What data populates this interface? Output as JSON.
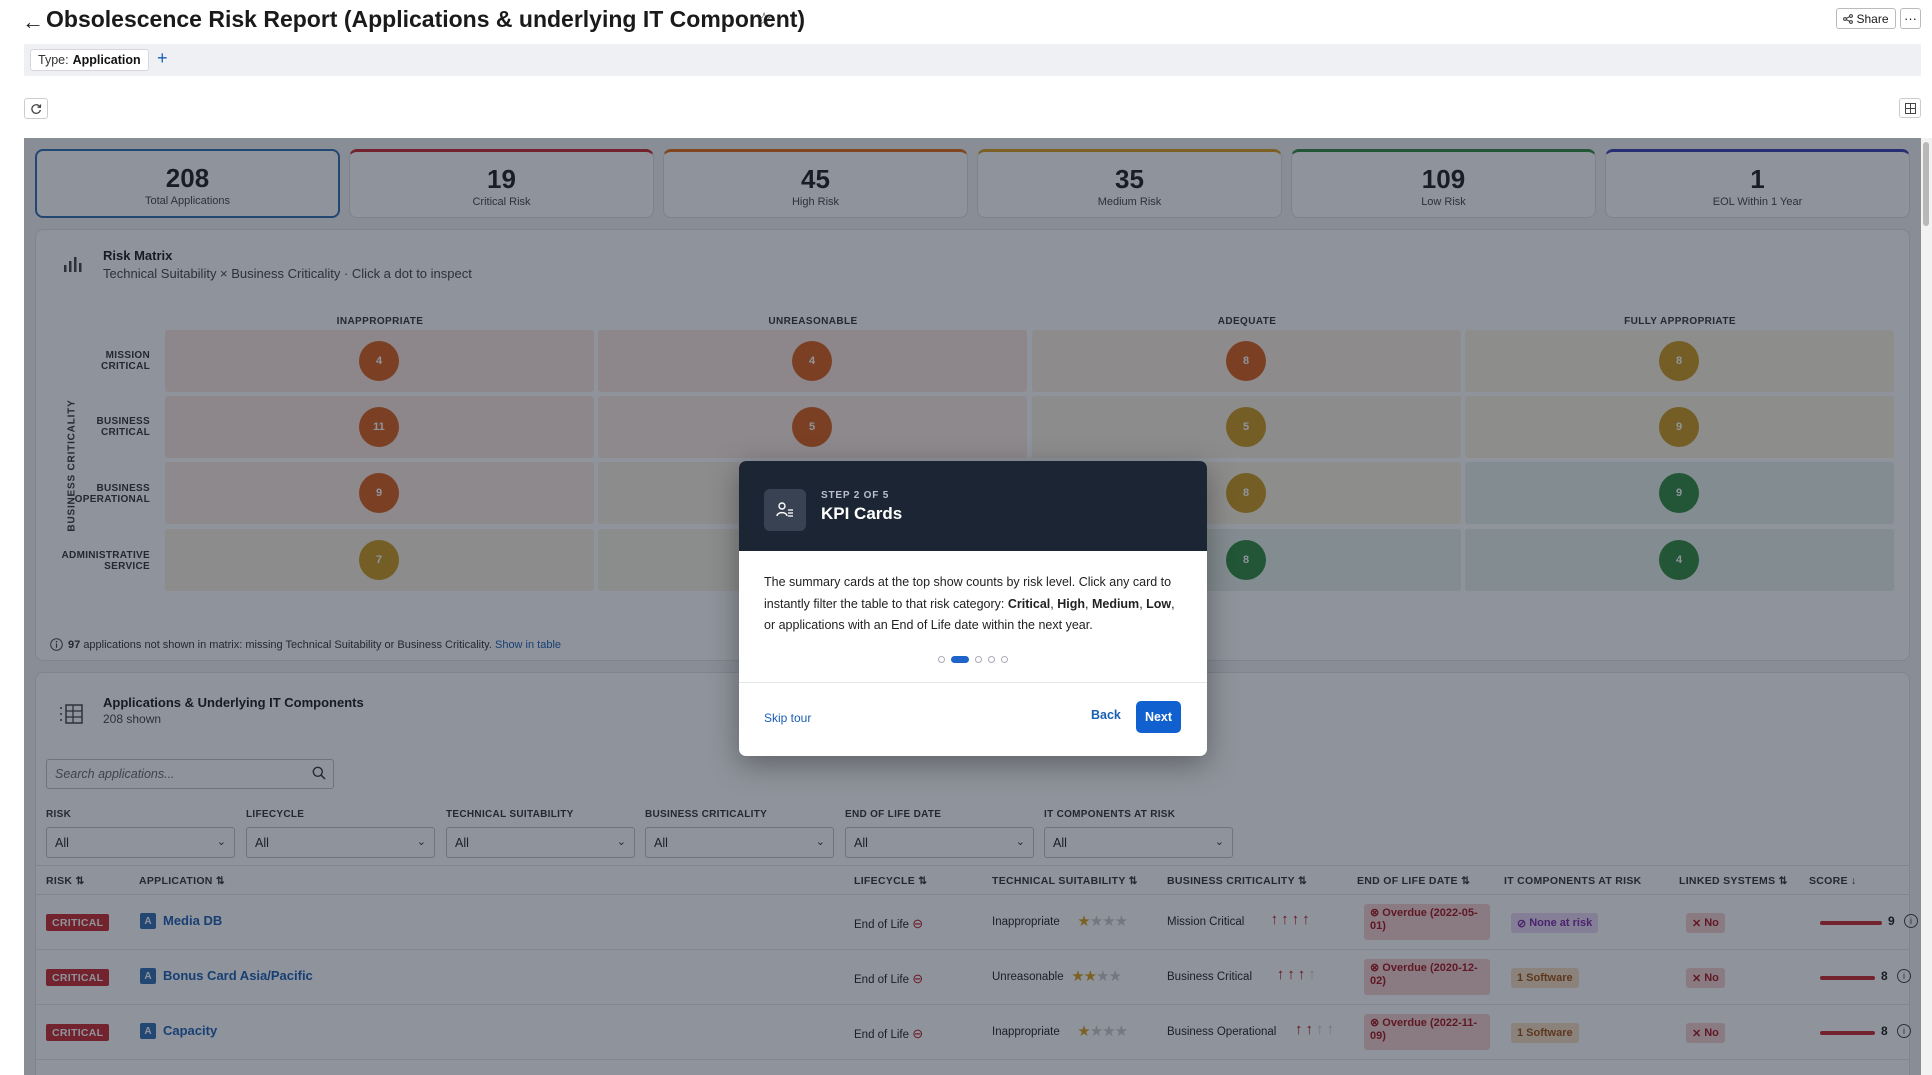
{
  "header": {
    "title": "Obsolescence Risk Report (Applications & underlying IT Component)",
    "share_label": "Share",
    "more_label": "···"
  },
  "filter": {
    "type_prefix": "Type:",
    "type_value": "Application",
    "add_label": "+"
  },
  "kpis": [
    {
      "value": "208",
      "label": "Total Applications",
      "color": "#2f6db3"
    },
    {
      "value": "19",
      "label": "Critical Risk",
      "color": "#c8292f"
    },
    {
      "value": "45",
      "label": "High Risk",
      "color": "#e06b14"
    },
    {
      "value": "35",
      "label": "Medium Risk",
      "color": "#d8a21b"
    },
    {
      "value": "109",
      "label": "Low Risk",
      "color": "#2e8b3e"
    },
    {
      "value": "1",
      "label": "EOL Within 1 Year",
      "color": "#3a3fb0"
    }
  ],
  "matrix": {
    "title": "Risk Matrix",
    "subtitle": "Technical Suitability × Business Criticality · Click a dot to inspect",
    "y_axis_label": "BUSINESS CRITICALITY",
    "columns": [
      "INAPPROPRIATE",
      "UNREASONABLE",
      "ADEQUATE",
      "FULLY APPROPRIATE"
    ],
    "rows": [
      {
        "label_1": "MISSION",
        "label_2": "CRITICAL",
        "values": [
          "4",
          "4",
          "8",
          "8"
        ]
      },
      {
        "label_1": "BUSINESS",
        "label_2": "CRITICAL",
        "values": [
          "11",
          "5",
          "5",
          "9"
        ]
      },
      {
        "label_1": "BUSINESS",
        "label_2": "OPERATIONAL",
        "values": [
          "9",
          "",
          "8",
          "9"
        ]
      },
      {
        "label_1": "ADMINISTRATIVE",
        "label_2": "SERVICE",
        "values": [
          "7",
          "",
          "8",
          "4"
        ]
      }
    ],
    "note_count": "97",
    "note_text": "applications not shown in matrix: missing Technical Suitability or Business Criticality.",
    "note_link": "Show in table"
  },
  "apps": {
    "title": "Applications & Underlying IT Components",
    "subtitle": "208 shown",
    "search_placeholder": "Search applications...",
    "filters": [
      {
        "label": "RISK",
        "value": "All"
      },
      {
        "label": "LIFECYCLE",
        "value": "All"
      },
      {
        "label": "TECHNICAL SUITABILITY",
        "value": "All"
      },
      {
        "label": "BUSINESS CRITICALITY",
        "value": "All"
      },
      {
        "label": "END OF LIFE DATE",
        "value": "All"
      },
      {
        "label": "IT COMPONENTS AT RISK",
        "value": "All"
      }
    ],
    "columns": [
      "RISK ⇅",
      "APPLICATION ⇅",
      "LIFECYCLE ⇅",
      "TECHNICAL SUITABILITY ⇅",
      "BUSINESS CRITICALITY ⇅",
      "END OF LIFE DATE ⇅",
      "IT COMPONENTS AT RISK",
      "LINKED SYSTEMS ⇅",
      "SCORE ↓"
    ],
    "rows": [
      {
        "risk": "CRITICAL",
        "icon": "A",
        "name": "Media DB",
        "lifecycle": "End of Life",
        "tech": "Inappropriate",
        "tech_stars": 1,
        "crit": "Mission Critical",
        "crit_arrows": 4,
        "eol_1": "Overdue (2022-05-",
        "eol_2": "01)",
        "components": "None at risk",
        "components_type": "purple",
        "linked": "No",
        "score": "9",
        "score_fraction": 1.0
      },
      {
        "risk": "CRITICAL",
        "icon": "A",
        "name": "Bonus Card Asia/Pacific",
        "lifecycle": "End of Life",
        "tech": "Unreasonable",
        "tech_stars": 2,
        "crit": "Business Critical",
        "crit_arrows": 3,
        "eol_1": "Overdue (2020-12-",
        "eol_2": "02)",
        "components": "1 Software",
        "components_type": "orange",
        "linked": "No",
        "score": "8",
        "score_fraction": 0.89
      },
      {
        "risk": "CRITICAL",
        "icon": "A",
        "name": "Capacity",
        "lifecycle": "End of Life",
        "tech": "Inappropriate",
        "tech_stars": 1,
        "crit": "Business Operational",
        "crit_arrows": 2,
        "eol_1": "Overdue (2022-11-",
        "eol_2": "09)",
        "components": "1 Software",
        "components_type": "orange",
        "linked": "No",
        "score": "8",
        "score_fraction": 0.89
      }
    ]
  },
  "tour": {
    "step": "STEP 2 OF 5",
    "title": "KPI Cards",
    "body_1": "The summary cards at the top show counts by risk level. Click any card to instantly filter the table to that risk category: ",
    "critical": "Critical",
    "comma_1": ", ",
    "high": "High",
    "comma_2": ", ",
    "medium": "Medium",
    "comma_3": ", ",
    "low": "Low",
    "body_2": ", or applications with an End of Life date within the next year.",
    "skip_label": "Skip tour",
    "back_label": "Back",
    "next_label": "Next",
    "current_step": 2,
    "total_steps": 5
  }
}
